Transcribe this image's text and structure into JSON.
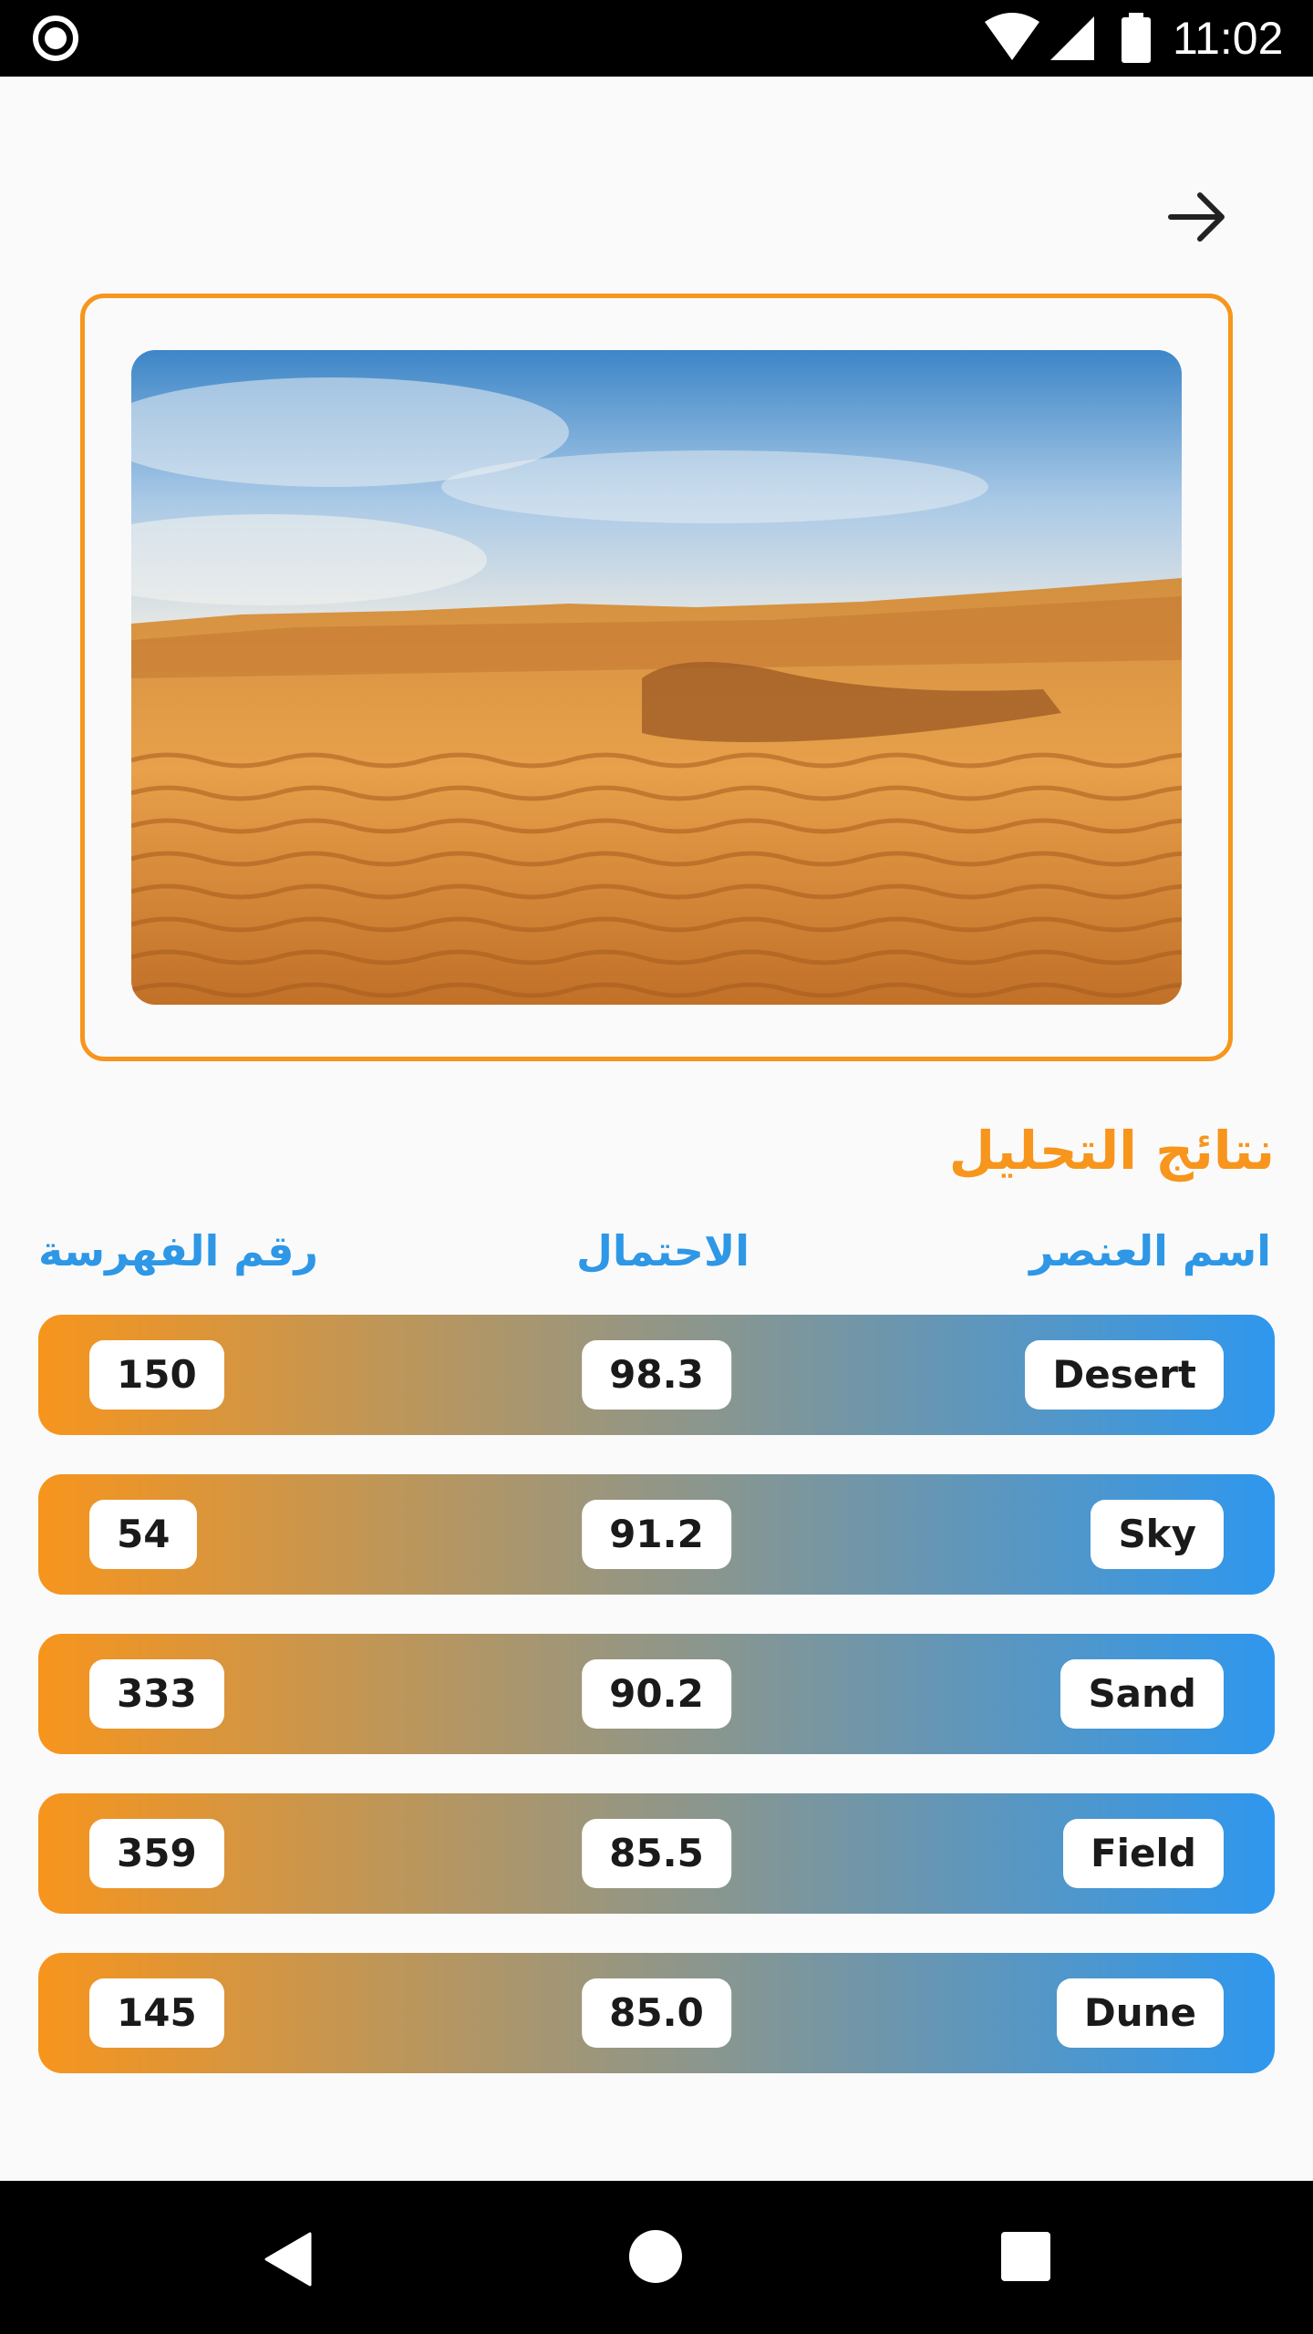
{
  "status_bar": {
    "time": "11:02",
    "icons": [
      "record-icon",
      "wifi-icon",
      "signal-icon",
      "battery-icon"
    ]
  },
  "header": {
    "back_icon": "arrow-right-icon"
  },
  "image": {
    "subject": "desert-dunes-photo"
  },
  "results": {
    "title": "نتائج التحليل",
    "columns": {
      "name": "اسم العنصر",
      "probability": "الاحتمال",
      "index": "رقم الفهرسة"
    },
    "rows": [
      {
        "name": "Desert",
        "probability": "98.3",
        "index": "150"
      },
      {
        "name": "Sky",
        "probability": "91.2",
        "index": "54"
      },
      {
        "name": "Sand",
        "probability": "90.2",
        "index": "333"
      },
      {
        "name": "Field",
        "probability": "85.5",
        "index": "359"
      },
      {
        "name": "Dune",
        "probability": "85.0",
        "index": "145"
      }
    ]
  },
  "nav_bar": {
    "icons": [
      "back-triangle-icon",
      "home-circle-icon",
      "recents-square-icon"
    ]
  },
  "colors": {
    "accent_orange": "#f7951d",
    "accent_blue": "#2e97ee"
  }
}
